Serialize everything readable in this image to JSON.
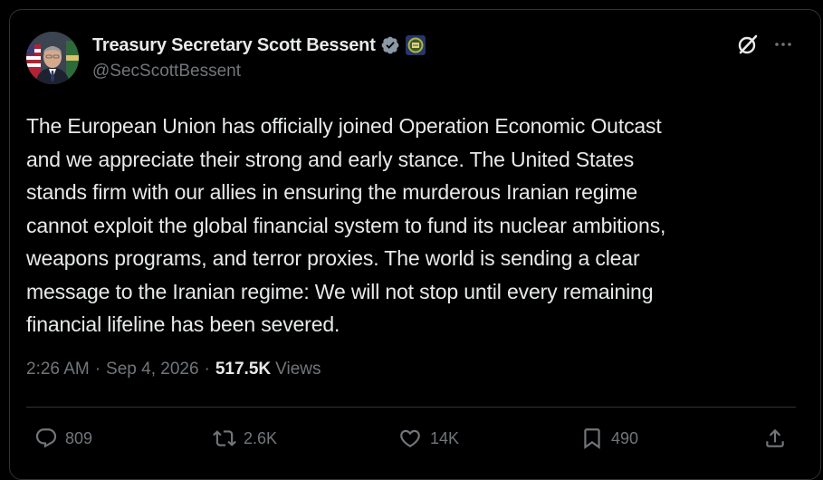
{
  "author": {
    "display_name": "Treasury Secretary Scott Bessent",
    "handle": "@SecScottBessent",
    "verified_badge_icon": "verified-check-icon",
    "affiliation_badge_icon": "treasury-seal-icon",
    "verified_color": "#8b98a5"
  },
  "top_actions": {
    "grok_icon": "grok-slash-icon",
    "more_icon": "more-dots-icon"
  },
  "tweet": {
    "lines": [
      "The European Union has officially joined Operation Economic Outcast",
      "and we appreciate their strong and early stance. The United States",
      "stands firm with our allies in ensuring the murderous Iranian regime",
      "cannot exploit the global financial system to fund its nuclear ambitions,",
      "weapons programs, and terror proxies. The world is sending a clear",
      "message to the Iranian regime: We will not stop until every remaining",
      "financial lifeline has been severed."
    ]
  },
  "meta": {
    "time": "2:26 AM",
    "separator": "·",
    "date": "Sep 4, 2026",
    "views_count": "517.5K",
    "views_label": "Views"
  },
  "actions": {
    "replies": "809",
    "reposts": "2.6K",
    "likes": "14K",
    "bookmarks": "490"
  },
  "colors": {
    "background": "#000000",
    "text_primary": "#e7e9ea",
    "text_secondary": "#71767b",
    "border": "#2f3336"
  }
}
